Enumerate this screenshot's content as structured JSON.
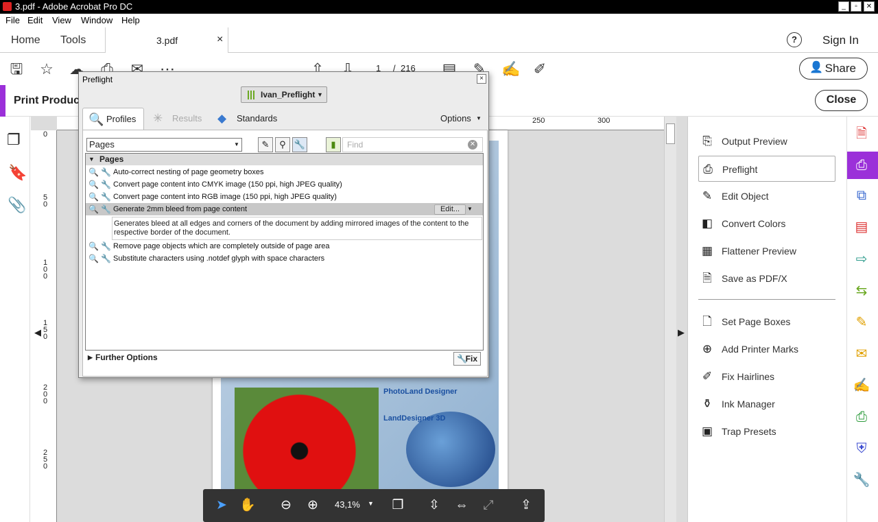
{
  "window": {
    "title": "3.pdf - Adobe Acrobat Pro DC"
  },
  "menu": [
    "File",
    "Edit",
    "View",
    "Window",
    "Help"
  ],
  "tabs": {
    "home": "Home",
    "tools": "Tools",
    "doc": "3.pdf",
    "close_glyph": "×"
  },
  "header": {
    "help_glyph": "?",
    "sign_in": "Sign In"
  },
  "toolbar": {
    "page_current": "1",
    "page_sep": "/",
    "page_total": "216",
    "share": "Share"
  },
  "printbar": {
    "title": "Print Produc",
    "close": "Close"
  },
  "rulers": {
    "top": [
      "250",
      "300"
    ],
    "left": [
      "0",
      "5 0",
      "1 0 0",
      "1 5 0",
      "2 0 0",
      "2 5 0"
    ]
  },
  "preflight": {
    "title": "Preflight",
    "close_glyph": "×",
    "profile": "Ivan_Preflight",
    "tabs": {
      "profiles": "Profiles",
      "results": "Results",
      "standards": "Standards",
      "options": "Options"
    },
    "filter_value": "Pages",
    "find_placeholder": "Find",
    "group": "Pages",
    "rows": [
      "Auto-correct nesting of page geometry boxes",
      "Convert page content into CMYK image (150 ppi, high JPEG quality)",
      "Convert page content into RGB image (150 ppi, high JPEG quality)",
      "Generate 2mm bleed from page content",
      "Remove page objects which are completely outside of page area",
      "Substitute characters using .notdef glyph with space characters"
    ],
    "edit": "Edit...",
    "description": "Generates bleed at all edges and corners of the document by adding mirrored images of the content to the respective border of the document.",
    "further_options": "Further Options",
    "fix": "Fix"
  },
  "page_image_text": {
    "line1": "PhotoLand Designer",
    "line2": "LandDesigner 3D"
  },
  "right_panel": {
    "items": [
      "Output Preview",
      "Preflight",
      "Edit Object",
      "Convert Colors",
      "Flattener Preview",
      "Save as PDF/X"
    ],
    "items2": [
      "Set Page Boxes",
      "Add Printer Marks",
      "Fix Hairlines",
      "Ink Manager",
      "Trap Presets"
    ]
  },
  "bottombar": {
    "zoom": "43,1%"
  },
  "colors": {
    "accent": "#9b30d9",
    "dark_bar": "#333333"
  }
}
